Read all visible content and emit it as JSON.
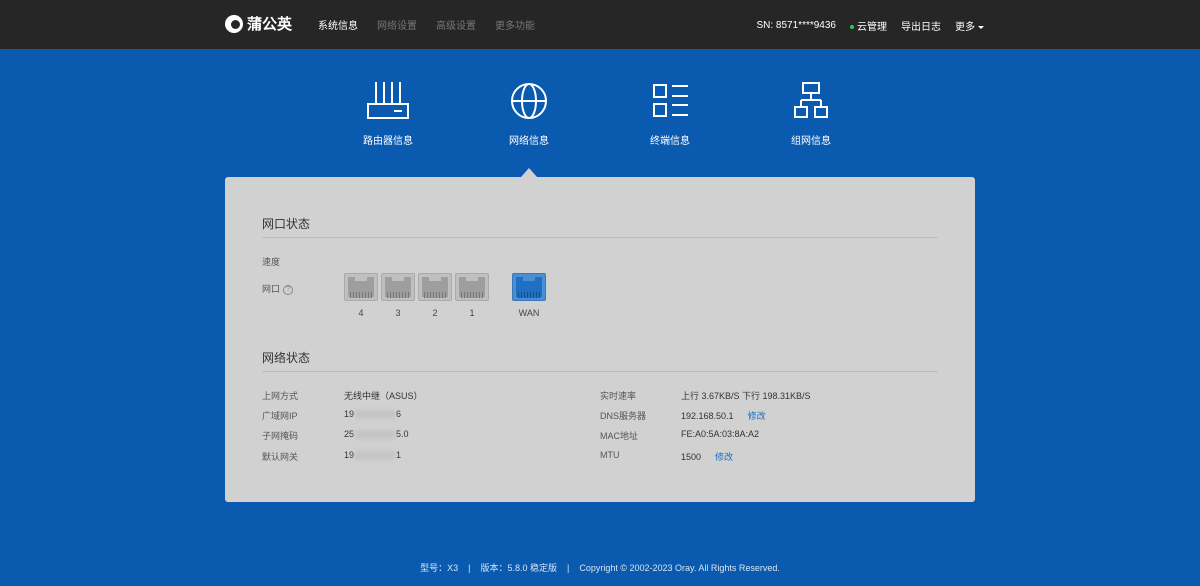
{
  "brand": {
    "name": "蒲公英"
  },
  "nav": {
    "system_info": "系统信息",
    "network_settings": "网络设置",
    "advanced_settings": "高级设置",
    "more_features": "更多功能"
  },
  "header_right": {
    "sn": "SN: 8571****9436",
    "cloud": "云管理",
    "export_log": "导出日志",
    "more": "更多"
  },
  "tabs": {
    "router": "路由器信息",
    "network": "网络信息",
    "terminal": "终端信息",
    "mesh": "组网信息"
  },
  "port_status": {
    "title": "网口状态",
    "speed_label": "速度",
    "port_label": "网口",
    "ports": [
      "4",
      "3",
      "2",
      "1",
      "WAN"
    ]
  },
  "network_status": {
    "title": "网络状态",
    "left": {
      "access_label": "上网方式",
      "access_value": "无线中继（ASUS）",
      "wan_ip_label": "广域网IP",
      "wan_ip_start": "19",
      "wan_ip_end": "6",
      "mask_label": "子网掩码",
      "mask_start": "25",
      "mask_end": "5.0",
      "gateway_label": "默认网关",
      "gateway_start": "19",
      "gateway_end": "1"
    },
    "right": {
      "speed_label": "实时速率",
      "speed_value": "上行 3.67KB/S  下行 198.31KB/S",
      "dns_label": "DNS服务器",
      "dns_value": "192.168.50.1",
      "dns_edit": "修改",
      "mac_label": "MAC地址",
      "mac_value": "FE:A0:5A:03:8A:A2",
      "mtu_label": "MTU",
      "mtu_value": "1500",
      "mtu_edit": "修改"
    }
  },
  "footer": {
    "model": "型号：X3",
    "version": "版本：5.8.0 稳定版",
    "copyright": "Copyright © 2002-2023 Oray. All Rights Reserved.",
    "separator": "|"
  }
}
